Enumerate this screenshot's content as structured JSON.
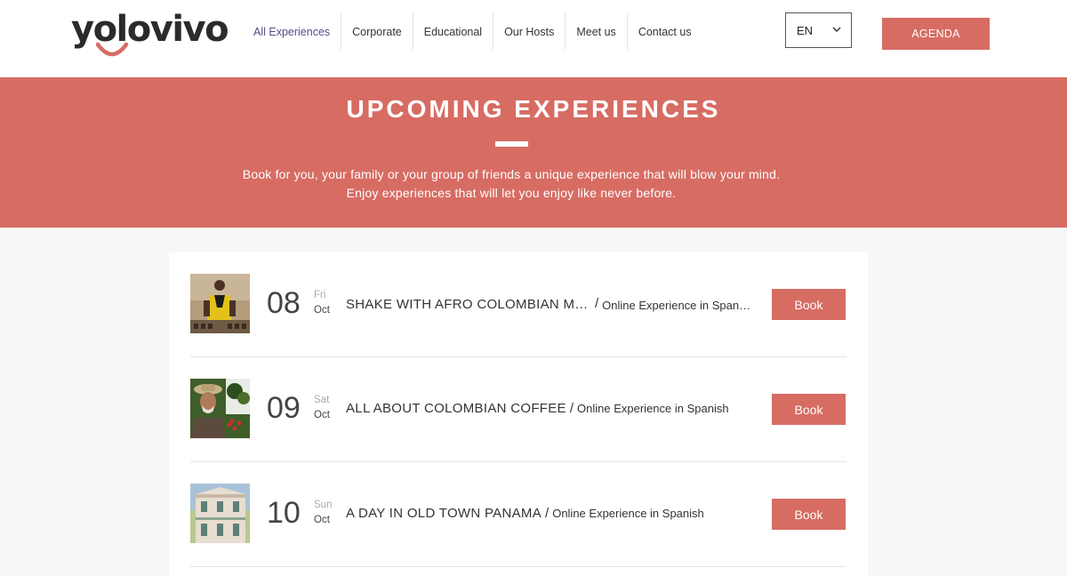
{
  "brand": {
    "name": "yolovivo",
    "accent": "#d76c63",
    "nav_active_color": "#5a4a8a"
  },
  "nav": {
    "items": [
      {
        "label": "All Experiences",
        "active": true
      },
      {
        "label": "Corporate"
      },
      {
        "label": "Educational"
      },
      {
        "label": "Our Hosts"
      },
      {
        "label": "Meet us"
      },
      {
        "label": "Contact us"
      }
    ]
  },
  "language": {
    "selected": "EN",
    "icon": "chevron-down-icon"
  },
  "agenda_label": "AGENDA",
  "hero": {
    "title": "UPCOMING EXPERIENCES",
    "description": "Book for you, your family or your group of friends a unique experience that will blow your mind. Enjoy experiences that will let you enjoy like never before."
  },
  "experiences": [
    {
      "day": "08",
      "weekday": "Fri",
      "month": "Oct",
      "title": "SHAKE WITH AFRO COLOMBIAN MUSIC",
      "separator": "/",
      "subtitle": "Online Experience in Spanish",
      "book_label": "Book"
    },
    {
      "day": "09",
      "weekday": "Sat",
      "month": "Oct",
      "title": "ALL ABOUT COLOMBIAN COFFEE",
      "separator": "/",
      "subtitle": "Online Experience in Spanish",
      "book_label": "Book"
    },
    {
      "day": "10",
      "weekday": "Sun",
      "month": "Oct",
      "title": "A DAY IN OLD TOWN PANAMA",
      "separator": "/",
      "subtitle": "Online Experience in Spanish",
      "book_label": "Book"
    }
  ]
}
